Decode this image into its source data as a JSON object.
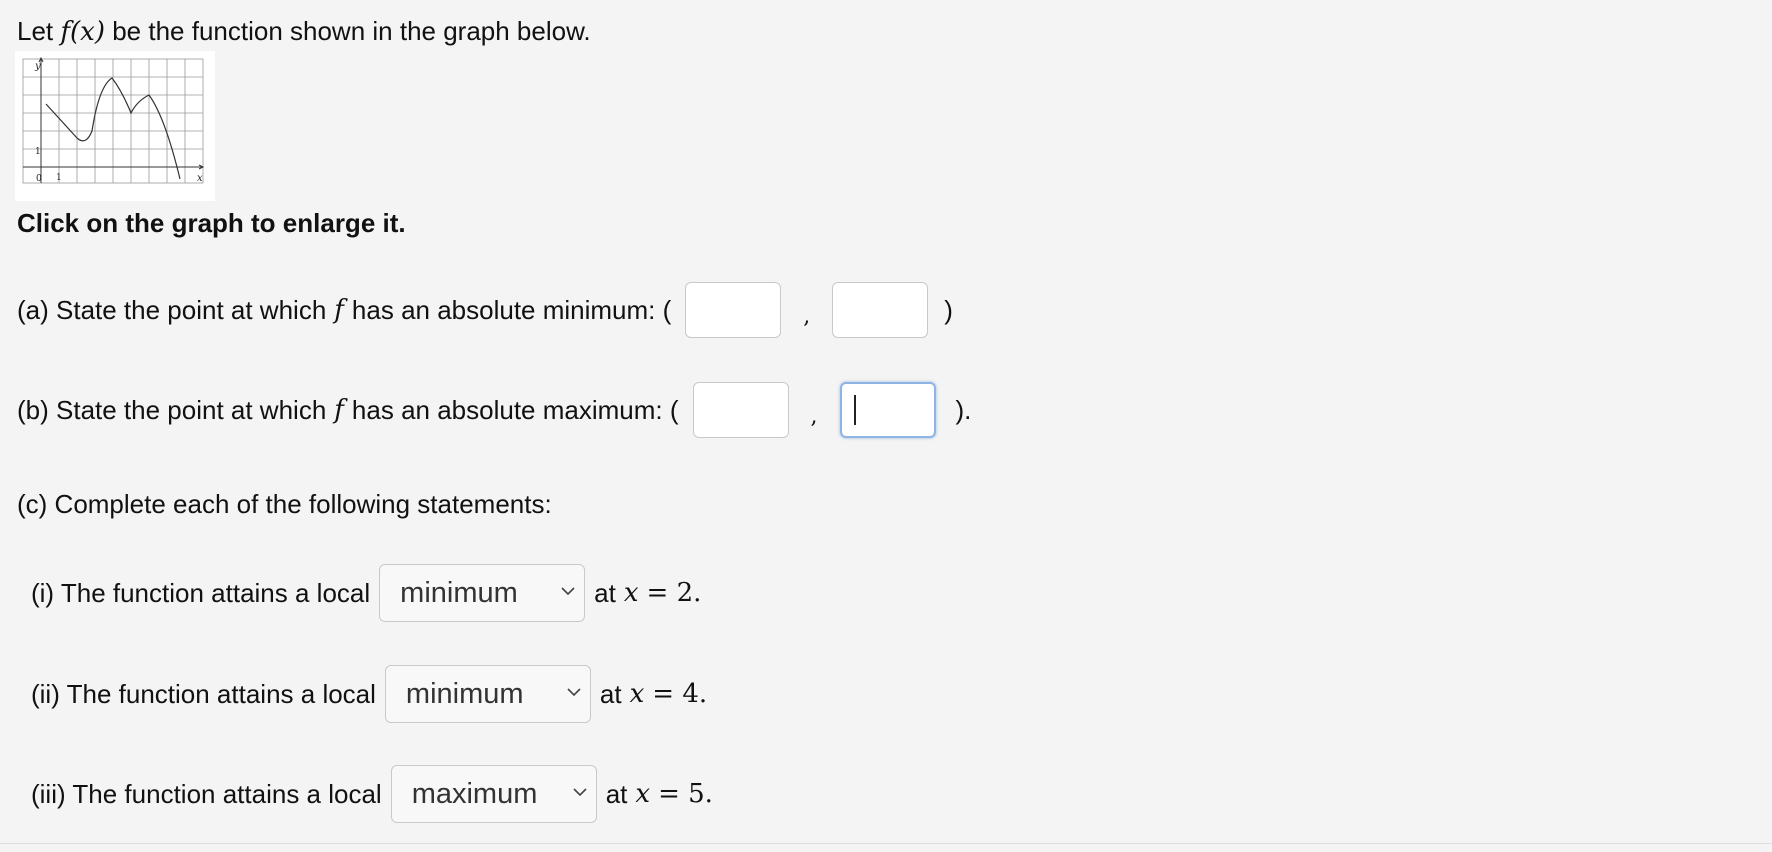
{
  "intro": {
    "prefix": "Let",
    "function_expr": "f(x)",
    "suffix": "be the function shown in the graph below."
  },
  "graph": {
    "y_label": "y",
    "x_label": "x",
    "origin_label": "0",
    "x_tick_label": "1",
    "y_tick_label": "1"
  },
  "enlarge_hint": "Click on the graph to enlarge it.",
  "part_a": {
    "prefix": "(a) State the point at which",
    "var": "f",
    "suffix": "has an absolute minimum: (",
    "comma": ",",
    "close": ")",
    "x_value": "",
    "y_value": ""
  },
  "part_b": {
    "prefix": "(b) State the point at which",
    "var": "f",
    "suffix": "has an absolute maximum: (",
    "comma": ",",
    "close": ").",
    "x_value": "",
    "y_value": ""
  },
  "part_c": {
    "heading": "(c) Complete each of the following statements:",
    "items": [
      {
        "prefix": "(i) The function attains a local",
        "selected": "minimum",
        "at": "at",
        "var": "x",
        "equals": "= 2."
      },
      {
        "prefix": "(ii) The function attains a local",
        "selected": "minimum",
        "at": "at",
        "var": "x",
        "equals": "= 4."
      },
      {
        "prefix": "(iii) The function attains a local",
        "selected": "maximum",
        "at": "at",
        "var": "x",
        "equals": "= 5."
      }
    ]
  },
  "icons": {
    "dropdown": "chevron-down-icon"
  },
  "colors": {
    "focus_border": "#8fb3e3",
    "background": "#f4f4f4"
  }
}
